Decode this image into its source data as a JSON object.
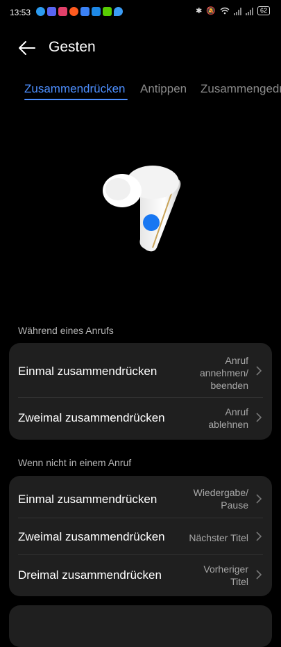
{
  "status_bar": {
    "time": "13:53",
    "battery": "62",
    "notification_icons": [
      {
        "name": "skype-icon",
        "color": "#2c9bf0"
      },
      {
        "name": "discord-icon",
        "color": "#5865f2"
      },
      {
        "name": "app-icon-pink",
        "color": "#e2406a"
      },
      {
        "name": "reddit-icon",
        "color": "#ff5a1f"
      },
      {
        "name": "mail-icon",
        "color": "#3b82f6"
      },
      {
        "name": "app-icon-blue",
        "color": "#1e88e5"
      },
      {
        "name": "duolingo-icon",
        "color": "#58cc02"
      },
      {
        "name": "maps-icon",
        "color": "#3b9cf5"
      }
    ]
  },
  "header": {
    "title": "Gesten"
  },
  "tabs": [
    {
      "label": "Zusammendrücken",
      "active": true
    },
    {
      "label": "Antippen",
      "active": false
    },
    {
      "label": "Zusammengedrückt halten",
      "active": false
    }
  ],
  "sections": [
    {
      "title": "Während eines Anrufs",
      "rows": [
        {
          "label": "Einmal zusammendrücken",
          "value": "Anruf\nannehmen/\nbeenden"
        },
        {
          "label": "Zweimal zusammendrücken",
          "value": "Anruf\nablehnen"
        }
      ]
    },
    {
      "title": "Wenn nicht in einem Anruf",
      "rows": [
        {
          "label": "Einmal zusammendrücken",
          "value": "Wiedergabe/\nPause"
        },
        {
          "label": "Zweimal zusammendrücken",
          "value": "Nächster Titel"
        },
        {
          "label": "Dreimal zusammendrücken",
          "value": "Vorheriger\nTitel"
        }
      ]
    }
  ],
  "colors": {
    "accent": "#4d8fff",
    "card": "#1f1f1f",
    "background": "#000000"
  }
}
